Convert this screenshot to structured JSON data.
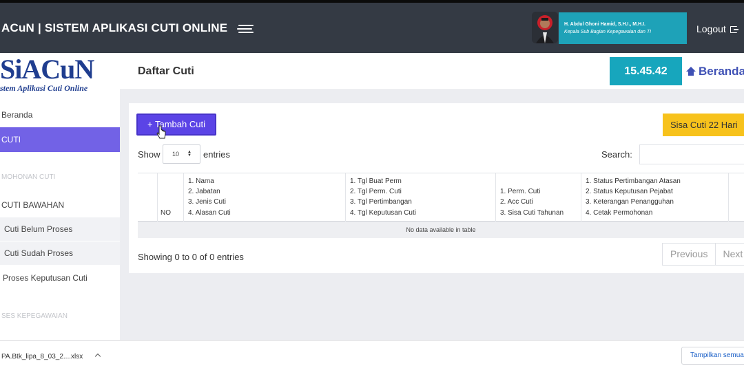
{
  "header": {
    "app_title": "ACuN | SISTEM APLIKASI CUTI ONLINE",
    "user_name": "H. Abdul Ghoni Hamid, S.H.I., M.H.I.",
    "user_role": "Kepala Sub Bagian Kepegawaian dan TI",
    "logout_label": "Logout"
  },
  "sidebar": {
    "logo": "SiACuN",
    "logo_subtitle": "stem Aplikasi Cuti Online",
    "items": [
      {
        "label": "Beranda"
      },
      {
        "label": "CUTI"
      },
      {
        "label": "MOHONAN CUTI"
      },
      {
        "label": "CUTI BAWAHAN"
      },
      {
        "label": "Cuti Belum Proses"
      },
      {
        "label": "Cuti Sudah Proses"
      },
      {
        "label": "Proses Keputusan Cuti"
      },
      {
        "label": "SES KEPEGAWAIAN"
      }
    ]
  },
  "content": {
    "page_title": "Daftar Cuti",
    "clock": "15.45.42",
    "breadcrumb_home": "Beranda"
  },
  "card": {
    "add_button": "+ Tambah Cuti",
    "sisa_cuti": "Sisa Cuti 22 Hari",
    "show_label": "Show",
    "entries_value": "10",
    "entries_label": "entries",
    "search_label": "Search:",
    "table": {
      "columns": [
        {
          "lines": [
            "",
            "",
            "",
            "NO"
          ]
        },
        {
          "lines": [
            "1. Nama",
            "2. Jabatan",
            "3. Jenis Cuti",
            "4. Alasan Cuti"
          ]
        },
        {
          "lines": [
            "1. Tgl Buat Perm",
            "2. Tgl Perm. Cuti",
            "3. Tgl Pertimbangan",
            "4. Tgl Keputusan Cuti"
          ]
        },
        {
          "lines": [
            "",
            "1. Perm. Cuti",
            "2. Acc Cuti",
            "3. Sisa Cuti Tahunan"
          ]
        },
        {
          "lines": [
            "1. Status Pertimbangan Atasan",
            "2. Status Keputusan Pejabat",
            "3. Keterangan Penangguhan",
            "4. Cetak Permohonan"
          ]
        }
      ],
      "empty_message": "No data available in table"
    },
    "showing": "Showing 0 to 0 of 0 entries",
    "pager": {
      "previous": "Previous",
      "next": "Next"
    }
  },
  "downloads": {
    "file": "PA.Btk_lipa_8_03_2....xlsx",
    "show_all": "Tampilkan semua"
  },
  "colors": {
    "header_bg": "#343a44",
    "accent_purple": "#7262e6",
    "add_button": "#5b44e6",
    "clock_teal": "#17a6bd",
    "sisa_yellow": "#f7c21c"
  }
}
